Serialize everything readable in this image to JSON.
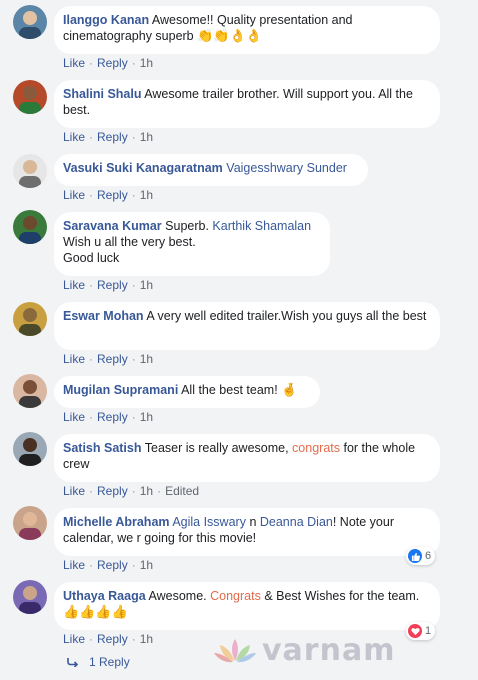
{
  "comments": [
    {
      "author": "Ilanggo Kanan",
      "text_parts": [
        "Awesome!! Quality presentation and cinematography superb"
      ],
      "emoji": "👏👏👌👌",
      "actions": {
        "like": "Like",
        "reply": "Reply",
        "time": "1h"
      }
    },
    {
      "author": "Shalini Shalu",
      "text_parts": [
        "Awesome trailer brother. Will support you. All the best."
      ],
      "actions": {
        "like": "Like",
        "reply": "Reply",
        "time": "1h"
      }
    },
    {
      "author": "Vasuki Suki Kanagaratnam",
      "mention": "Vaigesshwary Sunder",
      "actions": {
        "like": "Like",
        "reply": "Reply",
        "time": "1h"
      }
    },
    {
      "author": "Saravana Kumar",
      "text_parts": [
        "Superb.",
        "Wish u all the very best.",
        "Good luck"
      ],
      "mention": "Karthik Shamalan",
      "actions": {
        "like": "Like",
        "reply": "Reply",
        "time": "1h"
      }
    },
    {
      "author": "Eswar Mohan",
      "text_parts": [
        "A very well edited trailer.Wish you guys all the best"
      ],
      "actions": {
        "like": "Like",
        "reply": "Reply",
        "time": "1h"
      }
    },
    {
      "author": "Mugilan Supramani",
      "text_parts": [
        "All the best team!"
      ],
      "emoji": "🤞",
      "actions": {
        "like": "Like",
        "reply": "Reply",
        "time": "1h"
      }
    },
    {
      "author": "Satish Satish",
      "text_parts": [
        "Teaser is really awesome,",
        "for the whole crew"
      ],
      "hashtag": "congrats",
      "actions": {
        "like": "Like",
        "reply": "Reply",
        "time": "1h",
        "edited": "Edited"
      }
    },
    {
      "author": "Michelle Abraham",
      "mention": "Agila Isswary",
      "mention2": "Deanna Dian",
      "text_parts": [
        "n",
        "! Note your calendar, we r going for this movie!"
      ],
      "actions": {
        "like": "Like",
        "reply": "Reply",
        "time": "1h"
      },
      "reaction_count": "6"
    },
    {
      "author": "Uthaya Raaga",
      "text_parts": [
        "Awesome.",
        "& Best Wishes for the team."
      ],
      "hashtag": "Congrats",
      "emoji": "👍👍👍👍",
      "actions": {
        "like": "Like",
        "reply": "Reply",
        "time": "1h"
      },
      "reaction_count": "1"
    }
  ],
  "replies_link": "1 Reply",
  "watermark": "varnam",
  "colors": {
    "link": "#385898",
    "hashtag": "#e36b4b",
    "like_blue": "#1877f2",
    "love_red": "#f33e58",
    "background": "#f2f3f5"
  }
}
